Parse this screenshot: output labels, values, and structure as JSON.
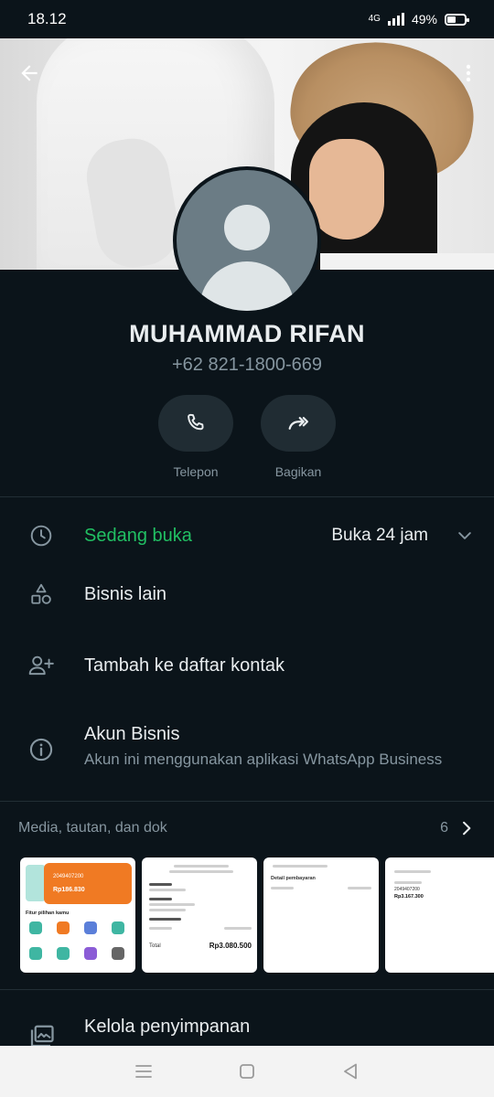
{
  "status_bar": {
    "time": "18.12",
    "network": "4G",
    "battery": "49%",
    "battery_level": 0.49
  },
  "profile": {
    "name": "MUHAMMAD RIFAN",
    "phone": "+62 821-1800-669"
  },
  "actions": [
    {
      "label": "Telepon",
      "icon": "phone-icon"
    },
    {
      "label": "Bagikan",
      "icon": "share-icon"
    }
  ],
  "hours": {
    "status": "Sedang buka",
    "hours": "Buka 24 jam"
  },
  "rows": {
    "other_business": "Bisnis lain",
    "add_contact": "Tambah ke daftar kontak",
    "business_account_title": "Akun Bisnis",
    "business_account_sub": "Akun ini menggunakan aplikasi WhatsApp Business"
  },
  "media": {
    "title": "Media, tautan, dan dok",
    "count": "6",
    "thumb1": {
      "account": "2049407200",
      "balance": "Rp186.830",
      "section": "Fitur pilihan kamu"
    },
    "thumb2": {
      "total_label": "Total",
      "total": "Rp3.080.500"
    },
    "thumb3": {
      "section": "Detail pembayaran"
    },
    "thumb4": {
      "account": "2049407200",
      "amount": "Rp3.167.300"
    }
  },
  "storage": {
    "title": "Kelola penyimpanan"
  },
  "colors": {
    "background": "#0b141a",
    "accent_green": "#21c063",
    "secondary_text": "#8696a0"
  }
}
